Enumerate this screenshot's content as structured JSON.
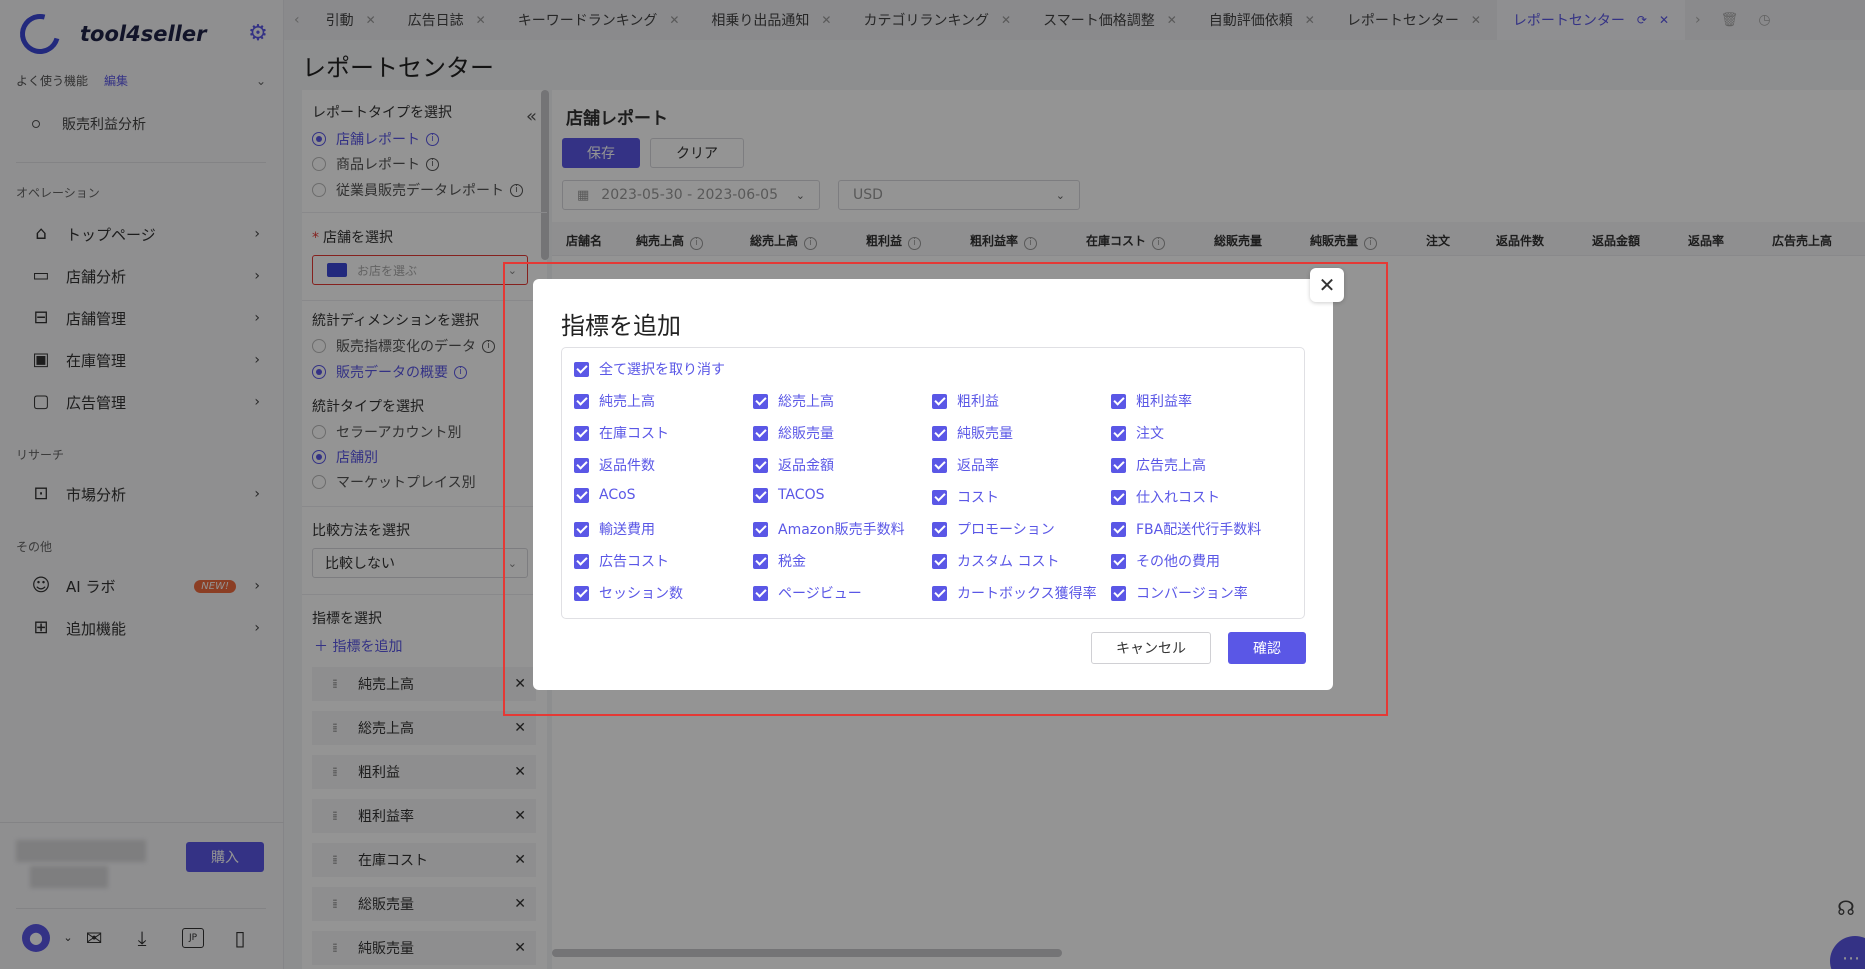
{
  "app": {
    "name": "tool4seller"
  },
  "sidebar": {
    "favorites_label": "よく使う機能",
    "favorites_edit": "編集",
    "favorite_item": "販売利益分析",
    "section_operation": "オペレーション",
    "section_research": "リサーチ",
    "section_other": "その他",
    "items": [
      {
        "label": "トップページ",
        "icon": "home-icon"
      },
      {
        "label": "店舗分析",
        "icon": "chart-monitor-icon"
      },
      {
        "label": "店舗管理",
        "icon": "store-icon"
      },
      {
        "label": "在庫管理",
        "icon": "box-icon"
      },
      {
        "label": "広告管理",
        "icon": "monitor-icon"
      },
      {
        "label": "市場分析",
        "icon": "shopping-bag-icon"
      },
      {
        "label": "AI ラボ",
        "icon": "robot-icon",
        "badge": "NEW!"
      },
      {
        "label": "追加機能",
        "icon": "apps-icon"
      }
    ],
    "buy_button": "購入",
    "lang_badge": "JP"
  },
  "tabs": [
    {
      "label": "引動"
    },
    {
      "label": "広告日誌"
    },
    {
      "label": "キーワードランキング"
    },
    {
      "label": "相乗り出品通知"
    },
    {
      "label": "カテゴリランキング"
    },
    {
      "label": "スマート価格調整"
    },
    {
      "label": "自動評価依頼"
    },
    {
      "label": "レポートセンター"
    },
    {
      "label": "レポートセンター",
      "active": true
    }
  ],
  "page": {
    "title": "レポートセンター"
  },
  "filters": {
    "report_type_label": "レポートタイプを選択",
    "report_types": [
      "店舗レポート",
      "商品レポート",
      "従業員販売データレポート"
    ],
    "shop_label": "店舗を選択",
    "shop_placeholder": "お店を選ぶ",
    "dimension_label": "統計ディメンションを選択",
    "dimensions": [
      "販売指標変化のデータ",
      "販売データの概要"
    ],
    "stat_type_label": "統計タイプを選択",
    "stat_types": [
      "セラーアカウント別",
      "店舗別",
      "マーケットプレイス別"
    ],
    "compare_label": "比較方法を選択",
    "compare_value": "比較しない",
    "metrics_label": "指標を選択",
    "add_metric": "指標を追加",
    "selected_metrics": [
      "純売上高",
      "総売上高",
      "粗利益",
      "粗利益率",
      "在庫コスト",
      "総販売量",
      "純販売量"
    ]
  },
  "report": {
    "title": "店舗レポート",
    "save": "保存",
    "clear": "クリア",
    "date_range": "2023-05-30 - 2023-06-05",
    "currency": "USD",
    "columns": [
      "店舗名",
      "純売上高",
      "総売上高",
      "粗利益",
      "粗利益率",
      "在庫コスト",
      "総販売量",
      "純販売量",
      "注文",
      "返品件数",
      "返品金額",
      "返品率",
      "広告売上高"
    ]
  },
  "modal": {
    "title": "指標を追加",
    "select_all": "全て選択を取り消す",
    "options": [
      "純売上高",
      "総売上高",
      "粗利益",
      "粗利益率",
      "在庫コスト",
      "総販売量",
      "純販売量",
      "注文",
      "返品件数",
      "返品金額",
      "返品率",
      "広告売上高",
      "ACoS",
      "TACOS",
      "コスト",
      "仕入れコスト",
      "輸送費用",
      "Amazon販売手数料",
      "プロモーション",
      "FBA配送代行手数料",
      "広告コスト",
      "税金",
      "カスタム コスト",
      "その他の費用",
      "セッション数",
      "ページビュー",
      "カートボックス獲得率",
      "コンバージョン率"
    ],
    "cancel": "キャンセル",
    "confirm": "確認"
  },
  "colors": {
    "accent": "#5a57e6",
    "highlight": "#e53935"
  }
}
